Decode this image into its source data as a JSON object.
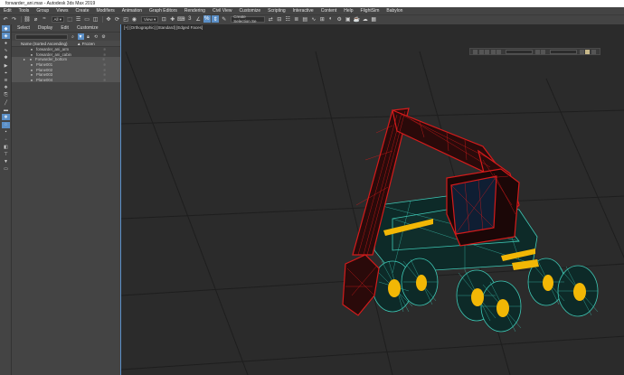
{
  "window": {
    "title": "forwarder_ani.max - Autodesk 3ds Max 2019"
  },
  "menu": {
    "items": [
      "Edit",
      "Tools",
      "Group",
      "Views",
      "Create",
      "Modifiers",
      "Animation",
      "Graph Editors",
      "Rendering",
      "Civil View",
      "Customize",
      "Scripting",
      "Interactive",
      "Content",
      "Help",
      "FlightSim",
      "Babylon"
    ]
  },
  "toolbar": {
    "selection_filter": "All",
    "view_dropdown": "View",
    "selection_set": "Create Selection Se",
    "snap_label": "3"
  },
  "explorer": {
    "tabs": [
      "Select",
      "Display",
      "Edit",
      "Customize"
    ],
    "column_name": "Name (Sorted Ascending)",
    "column_frozen": "▲ Frozen",
    "rows": [
      {
        "name": "forwarder_ani_arm"
      },
      {
        "name": "forwarder_ani_cabin"
      },
      {
        "name": "Forwarder_bottom"
      },
      {
        "name": "Plane001"
      },
      {
        "name": "Plane002"
      },
      {
        "name": "Plane003"
      },
      {
        "name": "Plane004"
      }
    ]
  },
  "viewport": {
    "label": "[+] [Orthographic] [Standard] [Edged Faces]"
  },
  "colors": {
    "accent": "#5b8fc7",
    "arm_wire": "#d41b1b",
    "body_wire": "#3ec9b6",
    "yellow": "#f2b705"
  }
}
